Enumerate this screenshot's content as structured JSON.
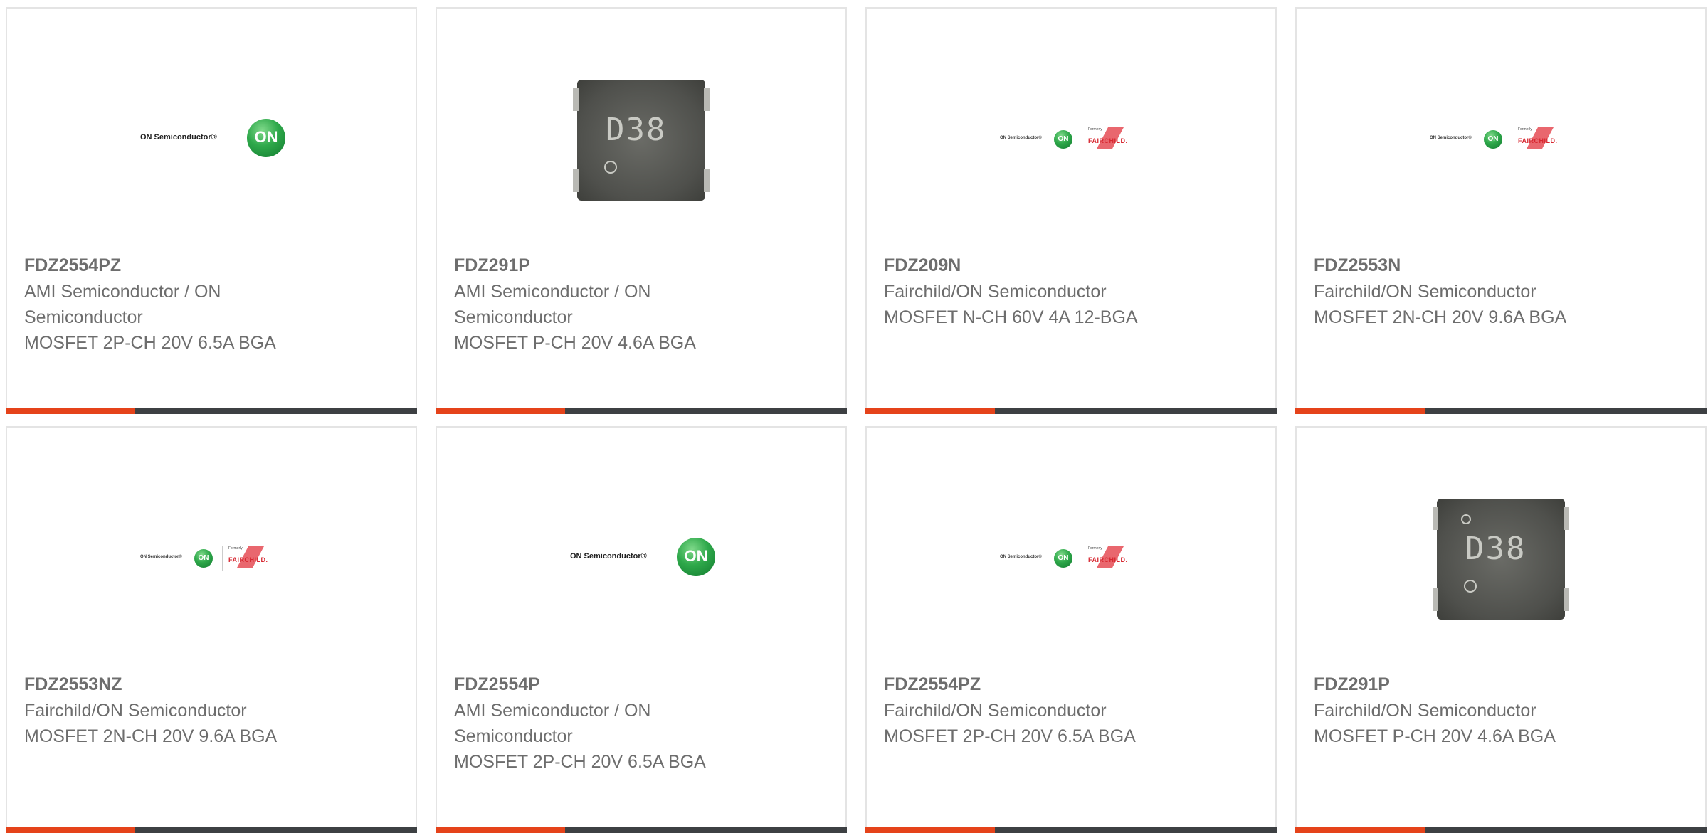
{
  "products": [
    {
      "part": "FDZ2554PZ",
      "manufacturer": "AMI Semiconductor / ON Semiconductor",
      "description": "MOSFET 2P-CH 20V 6.5A BGA",
      "image": "on-semiconductor-logo"
    },
    {
      "part": "FDZ291P",
      "manufacturer": "AMI Semiconductor / ON Semiconductor",
      "description": "MOSFET P-CH 20V 4.6A BGA",
      "image": "chip-d38"
    },
    {
      "part": "FDZ209N",
      "manufacturer": "Fairchild/ON Semiconductor",
      "description": "MOSFET N-CH 60V 4A 12-BGA",
      "image": "on-fairchild-logo"
    },
    {
      "part": "FDZ2553N",
      "manufacturer": "Fairchild/ON Semiconductor",
      "description": "MOSFET 2N-CH 20V 9.6A BGA",
      "image": "on-fairchild-logo"
    },
    {
      "part": "FDZ2553NZ",
      "manufacturer": "Fairchild/ON Semiconductor",
      "description": "MOSFET 2N-CH 20V 9.6A BGA",
      "image": "on-fairchild-logo"
    },
    {
      "part": "FDZ2554P",
      "manufacturer": "AMI Semiconductor / ON Semiconductor",
      "description": "MOSFET 2P-CH 20V 6.5A BGA",
      "image": "on-semiconductor-logo"
    },
    {
      "part": "FDZ2554PZ",
      "manufacturer": "Fairchild/ON Semiconductor",
      "description": "MOSFET 2P-CH 20V 6.5A BGA",
      "image": "on-fairchild-logo"
    },
    {
      "part": "FDZ291P",
      "manufacturer": "Fairchild/ON Semiconductor",
      "description": "MOSFET P-CH 20V 4.6A BGA",
      "image": "chip-d38"
    }
  ],
  "logo_text": {
    "on_semiconductor": "ON Semiconductor®",
    "on": "ON",
    "formerly": "Formerly",
    "fairchild": "FAIRCHILD.",
    "chip_marking": "D38"
  },
  "colors": {
    "accent_bar": "#e5431a",
    "bar": "#3d4043",
    "text": "#6d6d6d"
  }
}
